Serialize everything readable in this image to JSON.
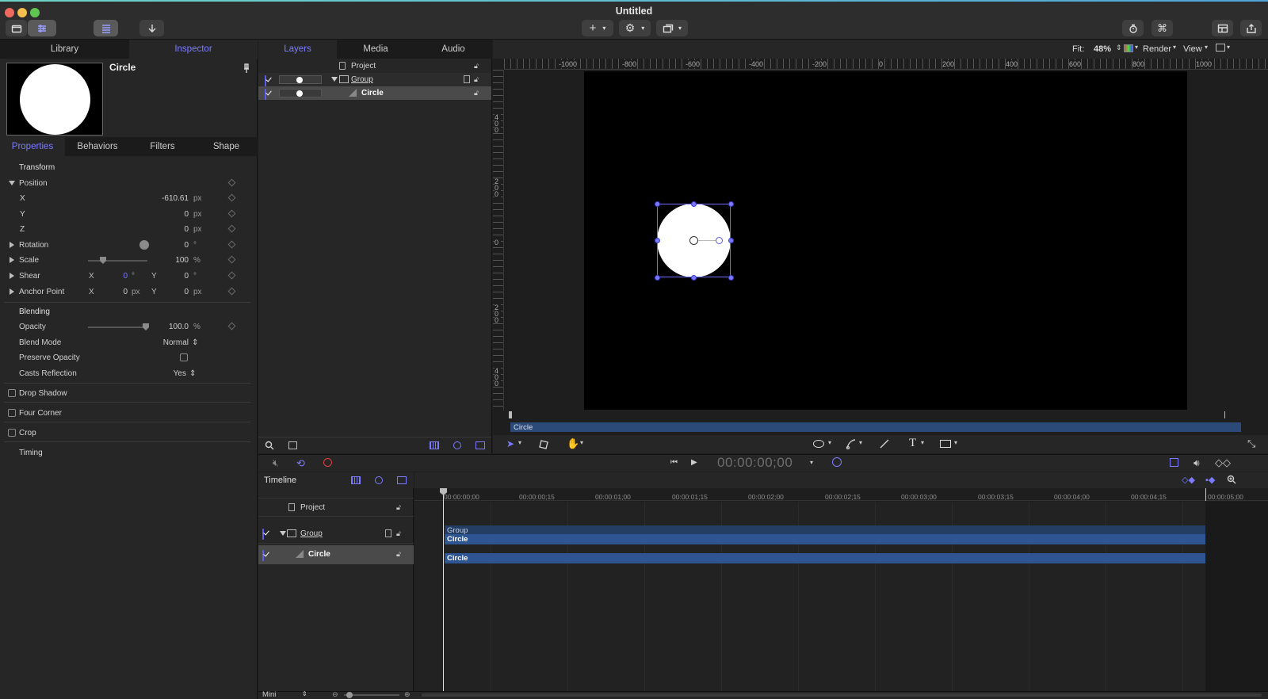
{
  "window": {
    "title": "Untitled"
  },
  "toolbar": {
    "fit_label": "Fit:",
    "fit_value": "48%",
    "render_label": "Render",
    "view_label": "View"
  },
  "left_tabs": {
    "library": "Library",
    "inspector": "Inspector"
  },
  "inspector": {
    "object_name": "Circle",
    "tabs": [
      "Properties",
      "Behaviors",
      "Filters",
      "Shape"
    ],
    "transform_header": "Transform",
    "position_label": "Position",
    "x_label": "X",
    "x_value": "-610.61",
    "x_unit": "px",
    "y_label": "Y",
    "y_value": "0",
    "y_unit": "px",
    "z_label": "Z",
    "z_value": "0",
    "z_unit": "px",
    "rotation_label": "Rotation",
    "rotation_value": "0",
    "rotation_unit": "°",
    "scale_label": "Scale",
    "scale_value": "100",
    "scale_unit": "%",
    "shear_label": "Shear",
    "shear_x_label": "X",
    "shear_x_value": "0",
    "shear_x_unit": "°",
    "shear_y_label": "Y",
    "shear_y_value": "0",
    "shear_y_unit": "°",
    "anchor_label": "Anchor Point",
    "anchor_x_label": "X",
    "anchor_x_value": "0",
    "anchor_x_unit": "px",
    "anchor_y_label": "Y",
    "anchor_y_value": "0",
    "anchor_y_unit": "px",
    "blending_header": "Blending",
    "opacity_label": "Opacity",
    "opacity_value": "100.0",
    "opacity_unit": "%",
    "blend_mode_label": "Blend Mode",
    "blend_mode_value": "Normal",
    "preserve_opacity_label": "Preserve Opacity",
    "casts_reflection_label": "Casts Reflection",
    "casts_reflection_value": "Yes",
    "drop_shadow_label": "Drop Shadow",
    "four_corner_label": "Four Corner",
    "crop_label": "Crop",
    "timing_label": "Timing"
  },
  "layers_tabs": {
    "layers": "Layers",
    "media": "Media",
    "audio": "Audio"
  },
  "layers": {
    "project": "Project",
    "group": "Group",
    "circle": "Circle"
  },
  "canvas": {
    "ruler_top": [
      "-1000",
      "-800",
      "-600",
      "-400",
      "-200",
      "0",
      "200",
      "400",
      "600",
      "800",
      "1000"
    ],
    "ruler_left": [
      "400",
      "200",
      "0",
      "200",
      "400"
    ],
    "mini_timeline_label": "Circle"
  },
  "transport": {
    "timecode": "00:00:00;00"
  },
  "timeline": {
    "title": "Timeline",
    "rows": {
      "project": "Project",
      "group": "Group",
      "circle": "Circle"
    },
    "ticks": [
      "00:00:00;00",
      "00:00:00;15",
      "00:00:01;00",
      "00:00:01;15",
      "00:00:02;00",
      "00:00:02;15",
      "00:00:03;00",
      "00:00:03;15",
      "00:00:04;00",
      "00:00:04;15",
      "00:00:05;00"
    ],
    "bars": {
      "group_label": "Group",
      "group_circle": "Circle",
      "circle": "Circle"
    },
    "zoom_label": "Mini"
  },
  "colors": {
    "accent": "#7c7bff",
    "clip_blue": "#2b4a78",
    "canvas_bg": "#000000"
  }
}
